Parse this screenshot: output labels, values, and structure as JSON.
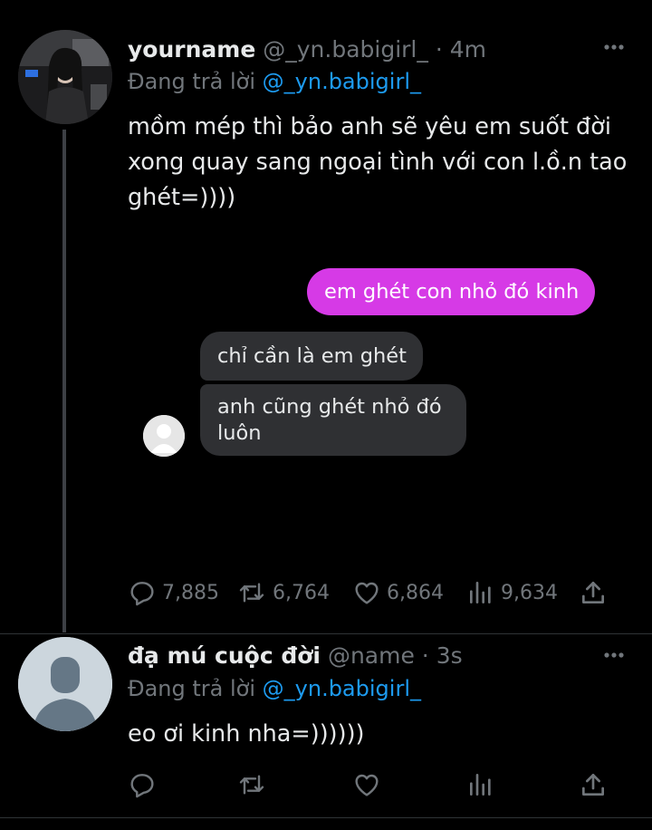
{
  "tweets": [
    {
      "display_name": "yourname",
      "handle": "@_yn.babigirl_",
      "dot": "·",
      "time": "4m",
      "replying_prefix": "Đang trả lời",
      "replying_to": "@_yn.babigirl_",
      "text": "mồm mép thì bảo anh sẽ yêu em suốt đời xong quay sang ngoại tình với con l.ồ.n tao ghét=))))",
      "chat": {
        "sent": "em ghét con nhỏ đó kinh",
        "received": [
          "chỉ cần là em ghét",
          "anh cũng ghét nhỏ đó luôn"
        ]
      },
      "stats": {
        "replies": "7,885",
        "retweets": "6,764",
        "likes": "6,864",
        "views": "9,634"
      }
    },
    {
      "display_name": "đạ mú cuộc đời",
      "handle": "@name",
      "dot": "·",
      "time": "3s",
      "replying_prefix": "Đang trả lời",
      "replying_to": "@_yn.babigirl_",
      "text": "eo ơi kinh nha=))))))"
    }
  ],
  "icons": {
    "more": "more-horizontal-icon",
    "reply": "reply-icon",
    "retweet": "retweet-icon",
    "like": "heart-icon",
    "views": "views-chart-icon",
    "share": "share-icon"
  },
  "colors": {
    "background": "#000000",
    "text": "#e7e9ea",
    "muted": "#71767b",
    "mention": "#1d9bf0",
    "sent_bubble": "#d63ae6",
    "received_bubble": "#2f3033"
  }
}
